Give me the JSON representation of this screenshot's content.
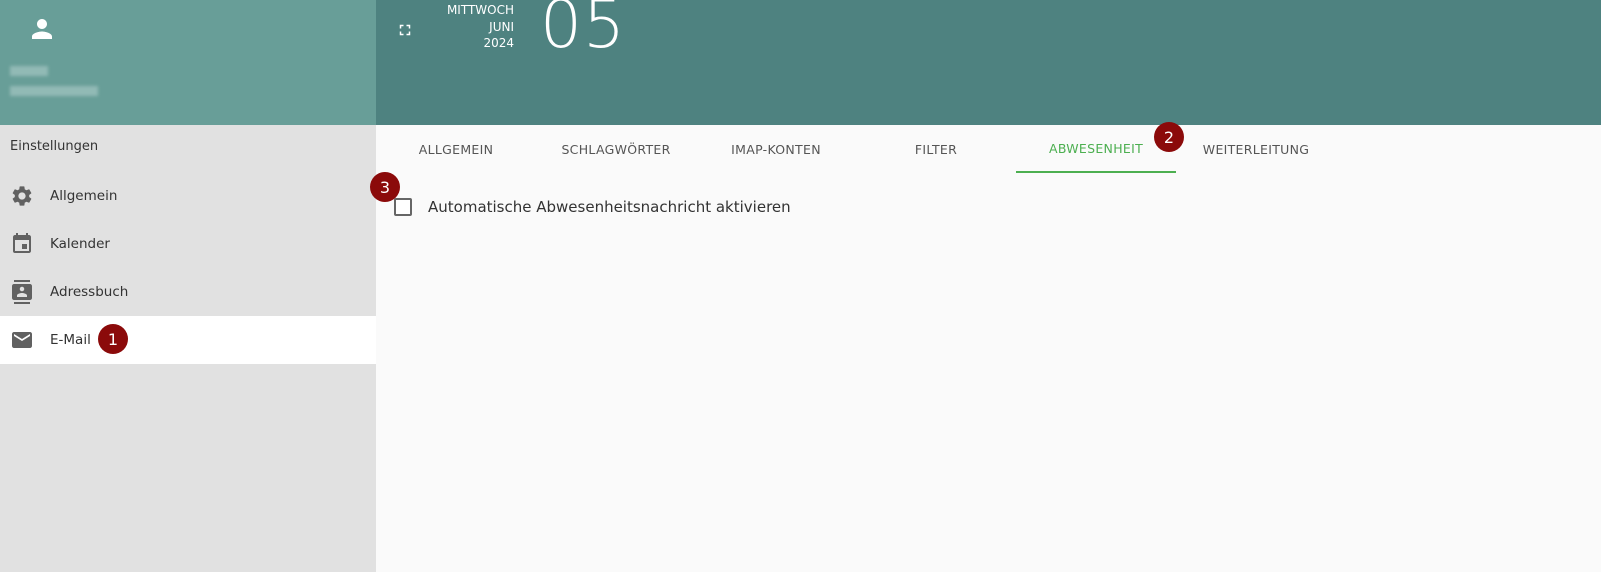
{
  "header": {
    "date": {
      "weekday": "MITTWOCH",
      "month": "JUNI",
      "year": "2024",
      "day": "05"
    }
  },
  "sidebar": {
    "title": "Einstellungen",
    "items": [
      {
        "label": "Allgemein",
        "icon": "gear-icon",
        "active": false
      },
      {
        "label": "Kalender",
        "icon": "calendar-icon",
        "active": false
      },
      {
        "label": "Adressbuch",
        "icon": "contacts-icon",
        "active": false
      },
      {
        "label": "E-Mail",
        "icon": "mail-icon",
        "active": true
      }
    ]
  },
  "tabs": [
    {
      "label": "ALLGEMEIN",
      "active": false
    },
    {
      "label": "SCHLAGWÖRTER",
      "active": false
    },
    {
      "label": "IMAP-KONTEN",
      "active": false
    },
    {
      "label": "FILTER",
      "active": false
    },
    {
      "label": "ABWESENHEIT",
      "active": true
    },
    {
      "label": "WEITERLEITUNG",
      "active": false
    }
  ],
  "content": {
    "checkbox_label": "Automatische Abwesenheitsnachricht aktivieren",
    "checked": false
  },
  "badges": [
    "1",
    "2",
    "3"
  ],
  "colors": {
    "user_header": "#689e98",
    "topbar": "#4e8280",
    "sidebar": "#e1e1e1",
    "accent": "#4caf50",
    "badge": "#8b0a0a"
  }
}
